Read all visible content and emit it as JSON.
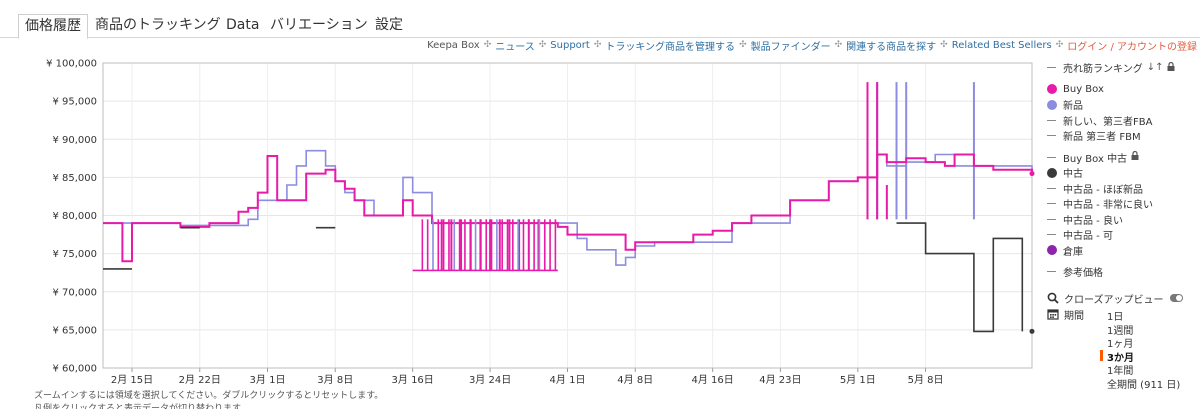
{
  "tabs": [
    "価格履歴",
    "商品のトラッキング",
    "Data",
    "バリエーション",
    "設定"
  ],
  "links": {
    "keepa_box": "Keepa Box",
    "separator": "✣",
    "items": [
      "ニュース",
      "Support",
      "トラッキング商品を管理する",
      "製品ファインダー",
      "関連する商品を探す",
      "Related Best Sellers"
    ],
    "login": "ログイン / アカウントの登録"
  },
  "hints": [
    "ズームインするには領域を選択してください。ダブルクリックするとリセットします。",
    "凡例をクリックすると表示データが切り替わります。"
  ],
  "legend": [
    {
      "label": "売れ筋ランキング",
      "kind": "dash",
      "icon": "sort-icon lock-icon"
    },
    {
      "label": "Buy Box",
      "kind": "dot",
      "color": "#e81aa9"
    },
    {
      "label": "新品",
      "kind": "dot",
      "color": "#8c8ce0"
    },
    {
      "label": "新しい、第三者FBA",
      "kind": "dash"
    },
    {
      "label": "新品 第三者 FBM",
      "kind": "dash"
    },
    {
      "label": "Buy Box 中古",
      "kind": "dash",
      "icon": "lock-icon"
    },
    {
      "label": "中古",
      "kind": "dot",
      "color": "#3a3a3a"
    },
    {
      "label": "中古品 - ほぼ新品",
      "kind": "dash"
    },
    {
      "label": "中古品 - 非常に良い",
      "kind": "dash"
    },
    {
      "label": "中古品 - 良い",
      "kind": "dash"
    },
    {
      "label": "中古品 - 可",
      "kind": "dash"
    },
    {
      "label": "倉庫",
      "kind": "dot",
      "color": "#8e24aa"
    },
    {
      "label": "参考価格",
      "kind": "dash"
    }
  ],
  "controls": {
    "closeup_label": "クローズアップビュー",
    "period_label": "期間",
    "periods": [
      "1日",
      "1週間",
      "1ヶ月",
      "3か月",
      "1年間",
      "全期間 (911 日)"
    ],
    "selected_period": "3か月"
  },
  "colors": {
    "buybox": "#e81aa9",
    "new": "#8c8ce0",
    "used": "#3a3a3a",
    "accent": "#ff5a00",
    "link": "#2e6fa3",
    "login": "#e15c3f"
  },
  "chart_data": {
    "type": "line",
    "x_type": "date",
    "x_ticks": [
      "2月 15日",
      "2月 22日",
      "3月 1日",
      "3月 8日",
      "3月 16日",
      "3月 24日",
      "4月 1日",
      "4月 8日",
      "4月 16日",
      "4月 23日",
      "5月 1日",
      "5月 8日"
    ],
    "y_ticks": [
      "¥ 60,000",
      "¥ 65,000",
      "¥ 70,000",
      "¥ 75,000",
      "¥ 80,000",
      "¥ 85,000",
      "¥ 90,000",
      "¥ 95,000",
      "¥ 100,000"
    ],
    "ylim": [
      60000,
      100000
    ],
    "xlim": [
      "2月 12日",
      "5月 19日"
    ],
    "grid": true,
    "legend_position": "right",
    "series": [
      {
        "name": "新品",
        "color": "#8c8ce0",
        "points": [
          [
            "2月 12日",
            79000
          ],
          [
            "2月 20日",
            78700
          ],
          [
            "2月 27日",
            79500
          ],
          [
            "2月 28日",
            82000
          ],
          [
            "3月 3日",
            84000
          ],
          [
            "3月 4日",
            86500
          ],
          [
            "3月 5日",
            88500
          ],
          [
            "3月 7日",
            88500
          ],
          [
            "3月 7日",
            86500
          ],
          [
            "3月 8日",
            85500
          ],
          [
            "3月 8日",
            84500
          ],
          [
            "3月 9日",
            83000
          ],
          [
            "3月 10日",
            82000
          ],
          [
            "3月 12日",
            80000
          ],
          [
            "3月 14日",
            80000
          ],
          [
            "3月 15日",
            85000
          ],
          [
            "3月 16日",
            83000
          ],
          [
            "3月 18日",
            79000
          ],
          [
            "4月 2日",
            77000
          ],
          [
            "4月 3日",
            75500
          ],
          [
            "4月 6日",
            73500
          ],
          [
            "4月 7日",
            74500
          ],
          [
            "4月 8日",
            76000
          ],
          [
            "4月 10日",
            76500
          ],
          [
            "4月 18日",
            79000
          ],
          [
            "4月 24日",
            82000
          ],
          [
            "4月 28日",
            84500
          ],
          [
            "5月 1日",
            85000
          ],
          [
            "5月 3日",
            88000
          ],
          [
            "5月 4日",
            86500
          ],
          [
            "5月 6日",
            87000
          ],
          [
            "5月 9日",
            88000
          ],
          [
            "5月 11日",
            86500
          ],
          [
            "5月 14日",
            86500
          ],
          [
            "5月 19日",
            85500
          ]
        ],
        "spikes": [
          [
            "5月 3日",
            97500
          ],
          [
            "5月 5日",
            97500
          ],
          [
            "5月 6日",
            97500
          ],
          [
            "5月 13日",
            97500
          ]
        ]
      },
      {
        "name": "Buy Box",
        "color": "#e81aa9",
        "points": [
          [
            "2月 12日",
            79000
          ],
          [
            "2月 13日",
            79000
          ],
          [
            "2月 14日",
            74000
          ],
          [
            "2月 15日",
            79000
          ],
          [
            "2月 20日",
            78500
          ],
          [
            "2月 23日",
            79000
          ],
          [
            "2月 26日",
            80500
          ],
          [
            "2月 27日",
            81000
          ],
          [
            "2月 28日",
            83000
          ],
          [
            "3月 1日",
            85000
          ],
          [
            "3月 1日",
            87800
          ],
          [
            "3月 2日",
            82000
          ],
          [
            "3月 4日",
            82000
          ],
          [
            "3月 5日",
            85500
          ],
          [
            "3月 7日",
            86000
          ],
          [
            "3月 8日",
            84500
          ],
          [
            "3月 9日",
            83500
          ],
          [
            "3月 10日",
            82000
          ],
          [
            "3月 11日",
            80000
          ],
          [
            "3月 14日",
            80000
          ],
          [
            "3月 15日",
            82000
          ],
          [
            "3月 16日",
            80000
          ],
          [
            "3月 18日",
            79000
          ],
          [
            "3月 30日",
            79000
          ],
          [
            "3月 31日",
            78500
          ],
          [
            "4月 1日",
            77500
          ],
          [
            "4月 7日",
            75500
          ],
          [
            "4月 8日",
            76500
          ],
          [
            "4月 10日",
            76500
          ],
          [
            "4月 14日",
            77500
          ],
          [
            "4月 16日",
            78000
          ],
          [
            "4月 18日",
            79000
          ],
          [
            "4月 20日",
            80000
          ],
          [
            "4月 24日",
            82000
          ],
          [
            "4月 28日",
            84500
          ],
          [
            "5月 1日",
            85000
          ],
          [
            "5月 3日",
            88000
          ],
          [
            "5月 4日",
            87000
          ],
          [
            "5月 6日",
            87500
          ],
          [
            "5月 8日",
            87000
          ],
          [
            "5月 10日",
            86500
          ],
          [
            "5月 11日",
            88000
          ],
          [
            "5月 13日",
            86500
          ],
          [
            "5月 15日",
            86000
          ],
          [
            "5月 19日",
            85500
          ]
        ],
        "spikes": [
          [
            "3月 19日",
            72800
          ],
          [
            "3月 20日",
            72800
          ],
          [
            "3月 21日",
            72800
          ],
          [
            "3月 22日",
            72800
          ],
          [
            "3月 23日",
            72800
          ],
          [
            "3月 24日",
            72800
          ],
          [
            "3月 25日",
            72800
          ],
          [
            "3月 26日",
            72800
          ],
          [
            "3月 27日",
            72800
          ],
          [
            "3月 28日",
            72800
          ],
          [
            "3月 29日",
            72800
          ],
          [
            "5月 2日",
            97500
          ],
          [
            "5月 3日",
            97500
          ],
          [
            "5月 4日",
            84000
          ]
        ]
      },
      {
        "name": "中古",
        "color": "#3a3a3a",
        "segments": [
          [
            [
              "2月 12日",
              73000
            ],
            [
              "2月 15日",
              73000
            ]
          ],
          [
            [
              "2月 20日",
              78400
            ],
            [
              "2月 22日",
              78400
            ]
          ],
          [
            [
              "3月 6日",
              78400
            ],
            [
              "3月 8日",
              78400
            ]
          ],
          [
            [
              "5月 5日",
              79000
            ],
            [
              "5月 8日",
              79000
            ],
            [
              "5月 8日",
              75000
            ],
            [
              "5月 13日",
              75000
            ],
            [
              "5月 13日",
              64800
            ],
            [
              "5月 15日",
              64800
            ],
            [
              "5月 15日",
              77000
            ],
            [
              "5月 18日",
              77000
            ],
            [
              "5月 18日",
              64800
            ]
          ]
        ]
      }
    ]
  }
}
